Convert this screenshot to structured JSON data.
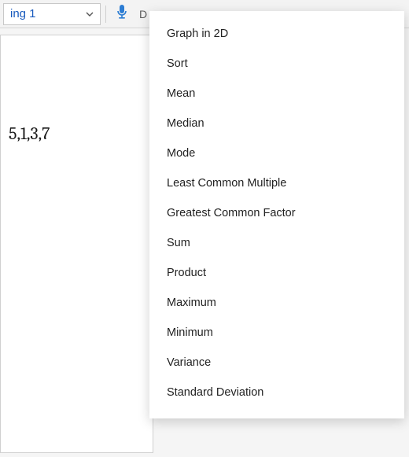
{
  "toolbar": {
    "style_selector_value": "ing 1",
    "truncated_label": "D"
  },
  "canvas": {
    "expression": "5,1,3,7"
  },
  "menu": {
    "items": [
      "Graph in 2D",
      "Sort",
      "Mean",
      "Median",
      "Mode",
      "Least Common Multiple",
      "Greatest Common Factor",
      "Sum",
      "Product",
      "Maximum",
      "Minimum",
      "Variance",
      "Standard Deviation"
    ]
  }
}
